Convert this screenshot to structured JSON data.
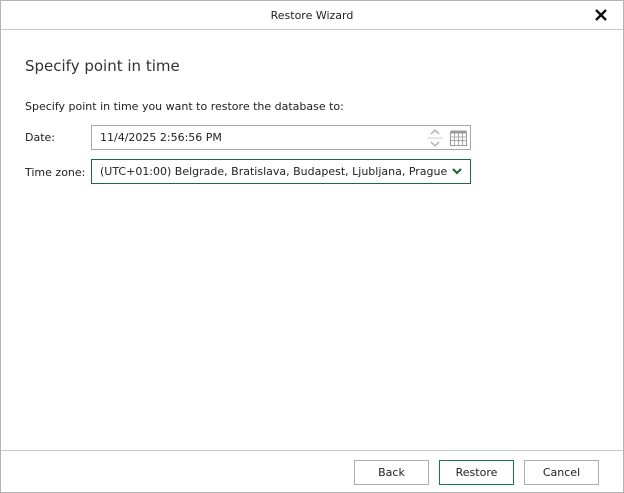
{
  "window": {
    "title": "Restore Wizard"
  },
  "page": {
    "heading": "Specify point in time",
    "description": "Specify point in time you want to restore the database to:"
  },
  "form": {
    "date_label": "Date:",
    "date_value": "11/4/2025 2:56:56 PM",
    "timezone_label": "Time zone:",
    "timezone_value": "(UTC+01:00) Belgrade, Bratislava, Budapest, Ljubljana, Prague"
  },
  "buttons": {
    "back": "Back",
    "restore": "Restore",
    "cancel": "Cancel"
  },
  "colors": {
    "accent": "#1e6b3a"
  }
}
